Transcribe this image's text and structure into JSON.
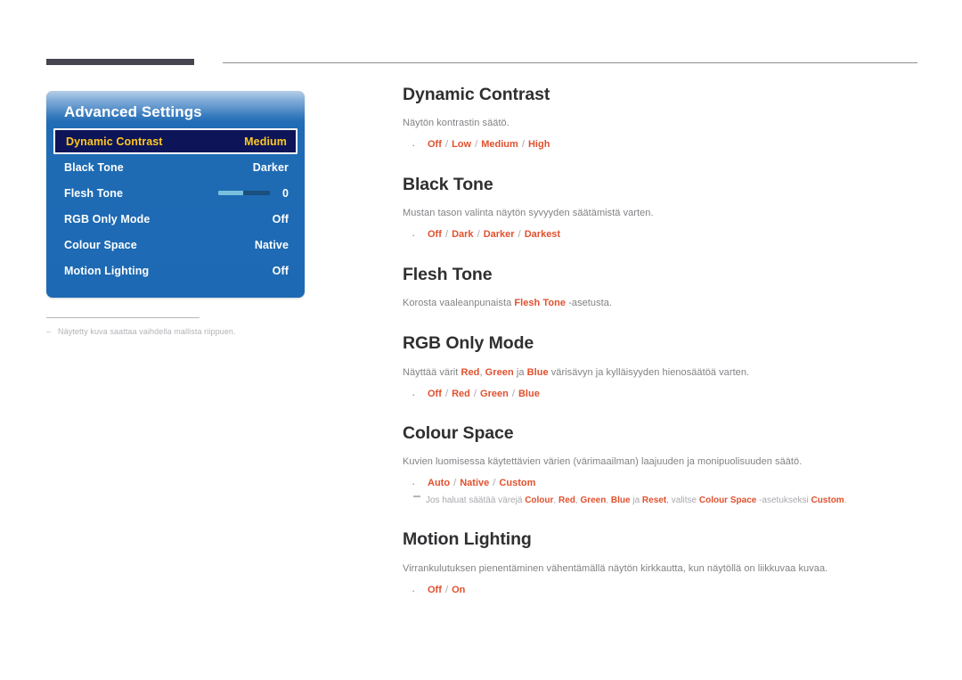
{
  "header": {
    "rule_thick_color": "#46454f",
    "rule_thin_color": "#8e8e94"
  },
  "osd": {
    "title": "Advanced Settings",
    "rows": [
      {
        "label": "Dynamic Contrast",
        "value": "Medium",
        "selected": true,
        "type": "value"
      },
      {
        "label": "Black Tone",
        "value": "Darker",
        "selected": false,
        "type": "value"
      },
      {
        "label": "Flesh Tone",
        "value": "0",
        "selected": false,
        "type": "slider",
        "slider_percent": 48
      },
      {
        "label": "RGB Only Mode",
        "value": "Off",
        "selected": false,
        "type": "value"
      },
      {
        "label": "Colour Space",
        "value": "Native",
        "selected": false,
        "type": "value"
      },
      {
        "label": "Motion Lighting",
        "value": "Off",
        "selected": false,
        "type": "value"
      }
    ],
    "colors": {
      "panel_blue": "#1d69b3",
      "selected_background": "#0d1458",
      "selected_text": "#ffc81e",
      "slider_fill": "#79c0dd",
      "slider_track": "#1b4f7d"
    }
  },
  "image_footnote": {
    "marker": "–",
    "text": "Näytetty kuva saattaa vaihdella mallista riippuen."
  },
  "sections": {
    "dynamic_contrast": {
      "heading": "Dynamic Contrast",
      "description": "Näytön kontrastin säätö.",
      "options": [
        "Off",
        "Low",
        "Medium",
        "High"
      ]
    },
    "black_tone": {
      "heading": "Black Tone",
      "description": "Mustan tason valinta näytön syvyyden säätämistä varten.",
      "options": [
        "Off",
        "Dark",
        "Darker",
        "Darkest"
      ]
    },
    "flesh_tone": {
      "heading": "Flesh Tone",
      "desc_pre": "Korosta vaaleanpunaista ",
      "desc_hl": "Flesh Tone",
      "desc_post": " -asetusta."
    },
    "rgb_only_mode": {
      "heading": "RGB Only Mode",
      "desc_pre": "Näyttää värit ",
      "desc_hl1": "Red",
      "desc_mid1": ", ",
      "desc_hl2": "Green",
      "desc_mid2": " ja ",
      "desc_hl3": "Blue",
      "desc_post": " värisävyn ja kylläisyyden hienosäätöä varten.",
      "options": [
        "Off",
        "Red",
        "Green",
        "Blue"
      ]
    },
    "colour_space": {
      "heading": "Colour Space",
      "description": "Kuvien luomisessa käytettävien värien (värimaailman) laajuuden ja monipuolisuuden säätö.",
      "options": [
        "Auto",
        "Native",
        "Custom"
      ],
      "note": {
        "pre": "Jos haluat säätää värejä ",
        "hl1": "Colour",
        "mid1": ", ",
        "hl2": "Red",
        "mid2": ", ",
        "hl3": "Green",
        "mid3": ", ",
        "hl4": "Blue",
        "mid4": " ja ",
        "hl5": "Reset",
        "mid5": ", valitse ",
        "hl6": "Colour Space",
        "mid6": " -asetukseksi ",
        "hl7": "Custom",
        "post": "."
      }
    },
    "motion_lighting": {
      "heading": "Motion Lighting",
      "description": "Virrankulutuksen pienentäminen vähentämällä näytön kirkkautta, kun näytöllä on liikkuvaa kuvaa.",
      "options": [
        "Off",
        "On"
      ]
    }
  }
}
